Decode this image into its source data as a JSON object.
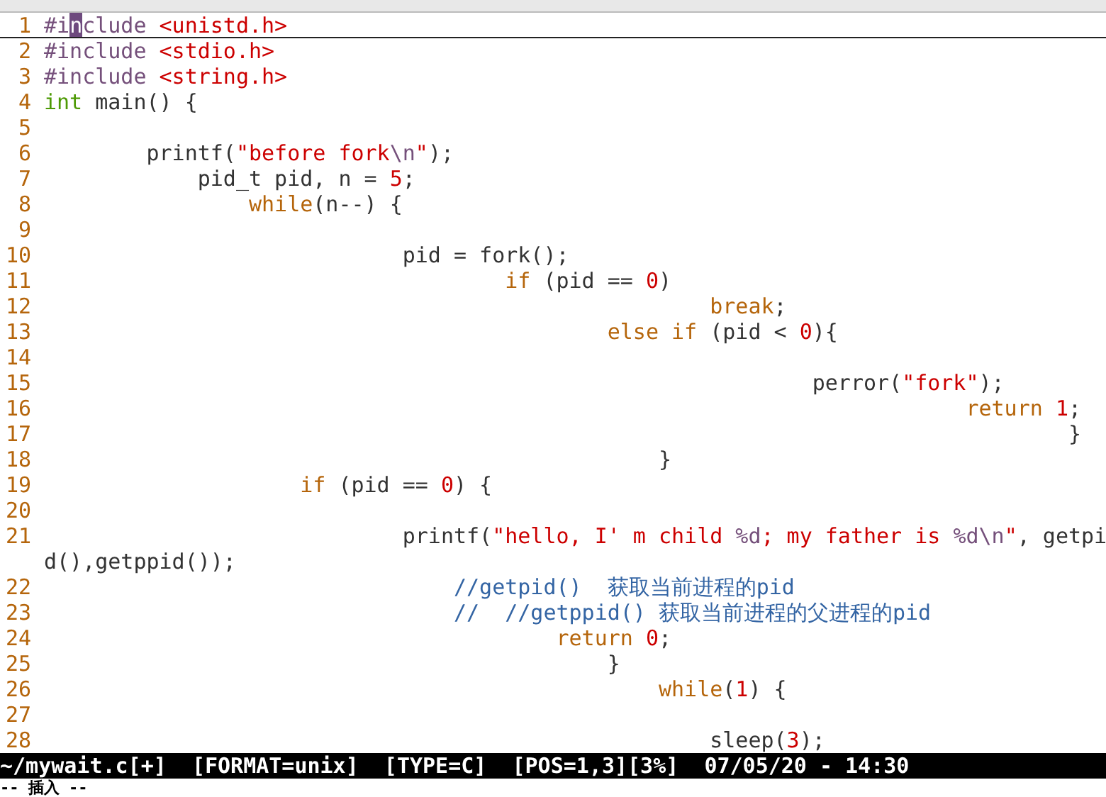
{
  "editor": {
    "lines": [
      {
        "kind": "line",
        "number": "1",
        "cursor_line": true,
        "segments": [
          {
            "kind": "preproc",
            "text": "#i"
          },
          {
            "kind": "cursor",
            "text": "n"
          },
          {
            "kind": "preproc",
            "text": "clude"
          },
          {
            "kind": "string",
            "text": " <unistd.h>"
          }
        ]
      },
      {
        "kind": "line",
        "number": "2",
        "cursor_line": false,
        "segments": [
          {
            "kind": "preproc",
            "text": "#include"
          },
          {
            "kind": "string",
            "text": " <stdio.h>"
          }
        ]
      },
      {
        "kind": "line",
        "number": "3",
        "cursor_line": false,
        "segments": [
          {
            "kind": "preproc",
            "text": "#include"
          },
          {
            "kind": "string",
            "text": " <string.h>"
          }
        ]
      },
      {
        "kind": "line",
        "number": "4",
        "cursor_line": false,
        "segments": [
          {
            "kind": "type",
            "text": "int"
          },
          {
            "kind": "plain",
            "text": " main() {"
          }
        ]
      },
      {
        "kind": "line",
        "number": "5",
        "cursor_line": false
      },
      {
        "kind": "line",
        "number": "6",
        "cursor_line": false,
        "segments": [
          {
            "kind": "plain",
            "text": "        printf("
          },
          {
            "kind": "string",
            "text": "\"before fork"
          },
          {
            "kind": "special",
            "text": "\\n"
          },
          {
            "kind": "string",
            "text": "\""
          },
          {
            "kind": "plain",
            "text": ");"
          }
        ]
      },
      {
        "kind": "line",
        "number": "7",
        "cursor_line": false,
        "segments": [
          {
            "kind": "plain",
            "text": "            pid_t pid, n = "
          },
          {
            "kind": "number",
            "text": "5"
          },
          {
            "kind": "plain",
            "text": ";"
          }
        ]
      },
      {
        "kind": "line",
        "number": "8",
        "cursor_line": false,
        "segments": [
          {
            "kind": "keyword",
            "text": "                while"
          },
          {
            "kind": "plain",
            "text": "(n--) {"
          }
        ]
      },
      {
        "kind": "line",
        "number": "9",
        "cursor_line": false
      },
      {
        "kind": "line",
        "number": "10",
        "cursor_line": false,
        "segments": [
          {
            "kind": "plain",
            "text": "                            pid = fork();"
          }
        ]
      },
      {
        "kind": "line",
        "number": "11",
        "cursor_line": false,
        "segments": [
          {
            "kind": "keyword",
            "text": "                                    if"
          },
          {
            "kind": "plain",
            "text": " (pid == "
          },
          {
            "kind": "number",
            "text": "0"
          },
          {
            "kind": "plain",
            "text": ")"
          }
        ]
      },
      {
        "kind": "line",
        "number": "12",
        "cursor_line": false,
        "segments": [
          {
            "kind": "keyword",
            "text": "                                                    break"
          },
          {
            "kind": "plain",
            "text": ";"
          }
        ]
      },
      {
        "kind": "line",
        "number": "13",
        "cursor_line": false,
        "segments": [
          {
            "kind": "keyword",
            "text": "                                            else if"
          },
          {
            "kind": "plain",
            "text": " (pid < "
          },
          {
            "kind": "number",
            "text": "0"
          },
          {
            "kind": "plain",
            "text": "){"
          }
        ]
      },
      {
        "kind": "line",
        "number": "14",
        "cursor_line": false
      },
      {
        "kind": "line",
        "number": "15",
        "cursor_line": false,
        "segments": [
          {
            "kind": "plain",
            "text": "                                                            perror("
          },
          {
            "kind": "string",
            "text": "\"fork\""
          },
          {
            "kind": "plain",
            "text": ");"
          }
        ]
      },
      {
        "kind": "line",
        "number": "16",
        "cursor_line": false,
        "segments": [
          {
            "kind": "keyword",
            "text": "                                                                        return "
          },
          {
            "kind": "number",
            "text": "1"
          },
          {
            "kind": "plain",
            "text": ";"
          }
        ]
      },
      {
        "kind": "line",
        "number": "17",
        "cursor_line": false,
        "segments": [
          {
            "kind": "plain",
            "text": "                                                                                }"
          }
        ]
      },
      {
        "kind": "line",
        "number": "18",
        "cursor_line": false,
        "segments": [
          {
            "kind": "plain",
            "text": "                                                }"
          }
        ]
      },
      {
        "kind": "line",
        "number": "19",
        "cursor_line": false,
        "segments": [
          {
            "kind": "keyword",
            "text": "                    if"
          },
          {
            "kind": "plain",
            "text": " (pid == "
          },
          {
            "kind": "number",
            "text": "0"
          },
          {
            "kind": "plain",
            "text": ") {"
          }
        ]
      },
      {
        "kind": "line",
        "number": "20",
        "cursor_line": false
      },
      {
        "kind": "line",
        "number": "21",
        "cursor_line": false,
        "segments": [
          {
            "kind": "plain",
            "text": "                            printf("
          },
          {
            "kind": "string",
            "text": "\"hello, I' m child "
          },
          {
            "kind": "special",
            "text": "%d"
          },
          {
            "kind": "string",
            "text": "; my father is "
          },
          {
            "kind": "special",
            "text": "%d\\n"
          },
          {
            "kind": "string",
            "text": "\""
          },
          {
            "kind": "plain",
            "text": ", getpi"
          }
        ]
      },
      {
        "kind": "wrap",
        "segments": [
          {
            "kind": "plain",
            "text": "d(),getppid());"
          }
        ]
      },
      {
        "kind": "line",
        "number": "22",
        "cursor_line": false,
        "segments": [
          {
            "kind": "comment",
            "text": "                                //getpid()  获取当前进程的pid"
          }
        ]
      },
      {
        "kind": "line",
        "number": "23",
        "cursor_line": false,
        "segments": [
          {
            "kind": "comment",
            "text": "                                //  //getppid() 获取当前进程的父进程的pid"
          }
        ]
      },
      {
        "kind": "line",
        "number": "24",
        "cursor_line": false,
        "segments": [
          {
            "kind": "keyword",
            "text": "                                        return "
          },
          {
            "kind": "number",
            "text": "0"
          },
          {
            "kind": "plain",
            "text": ";"
          }
        ]
      },
      {
        "kind": "line",
        "number": "25",
        "cursor_line": false,
        "segments": [
          {
            "kind": "plain",
            "text": "                                            }"
          }
        ]
      },
      {
        "kind": "line",
        "number": "26",
        "cursor_line": false,
        "segments": [
          {
            "kind": "keyword",
            "text": "                                                while"
          },
          {
            "kind": "plain",
            "text": "("
          },
          {
            "kind": "number",
            "text": "1"
          },
          {
            "kind": "plain",
            "text": ") {"
          }
        ]
      },
      {
        "kind": "line",
        "number": "27",
        "cursor_line": false
      },
      {
        "kind": "line",
        "number": "28",
        "cursor_line": false,
        "segments": [
          {
            "kind": "plain",
            "text": "                                                    sleep("
          },
          {
            "kind": "number",
            "text": "3"
          },
          {
            "kind": "plain",
            "text": ");"
          }
        ]
      }
    ]
  },
  "status_line": "~/mywait.c[+]  [FORMAT=unix]  [TYPE=C]  [POS=1,3][3%]  07/05/20 - 14:30",
  "mode_line": "-- 插入 --"
}
